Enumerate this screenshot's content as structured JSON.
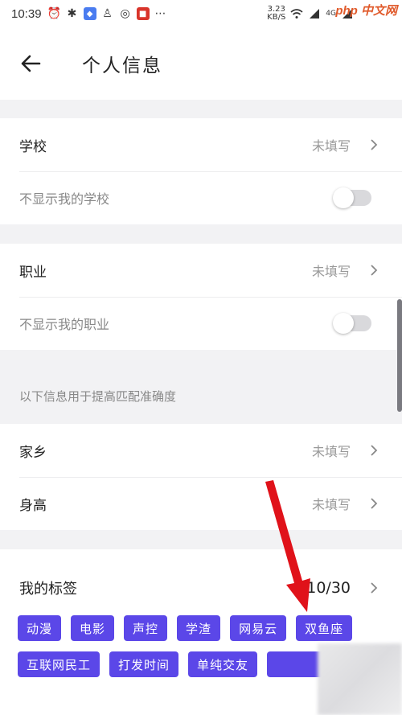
{
  "status_bar": {
    "time": "10:39",
    "net_speed_value": "3.23",
    "net_speed_unit": "KB/S",
    "signal_label": "4G",
    "watermark": "php 中文网",
    "icons": [
      "alarm-icon",
      "bluetooth-icon",
      "shield-app-icon",
      "qq-icon",
      "weibo-icon",
      "app-red-icon",
      "more-icon",
      "wifi-icon",
      "signal-icon",
      "battery-icon"
    ]
  },
  "header": {
    "back_icon": "arrow-left-icon",
    "title": "个人信息"
  },
  "school": {
    "label": "学校",
    "value": "未填写",
    "hide_label": "不显示我的学校",
    "hide_enabled": false
  },
  "career": {
    "label": "职业",
    "value": "未填写",
    "hide_label": "不显示我的职业",
    "hide_enabled": false
  },
  "hint": "以下信息用于提高匹配准确度",
  "hometown": {
    "label": "家乡",
    "value": "未填写"
  },
  "height": {
    "label": "身高",
    "value": "未填写"
  },
  "tags": {
    "label": "我的标签",
    "count": "10/30",
    "row1": [
      "动漫",
      "电影",
      "声控",
      "学渣",
      "网易云",
      "双鱼座"
    ],
    "row2": [
      "互联网民工",
      "打发时间",
      "单纯交友"
    ]
  },
  "colors": {
    "tag_bg": "#5b47e8",
    "annotation_arrow": "#e0121a"
  }
}
